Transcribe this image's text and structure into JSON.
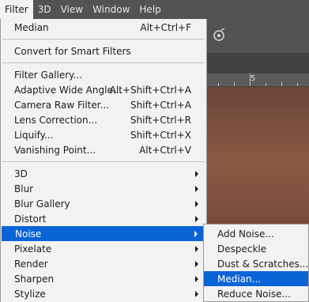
{
  "menubar": {
    "items": [
      {
        "label": "Filter",
        "active": true
      },
      {
        "label": "3D",
        "active": false
      },
      {
        "label": "View",
        "active": false
      },
      {
        "label": "Window",
        "active": false
      },
      {
        "label": "Help",
        "active": false
      }
    ]
  },
  "ruler": {
    "label": "5"
  },
  "filter_menu": {
    "last_filter": {
      "label": "Median",
      "shortcut": "Alt+Ctrl+F"
    },
    "convert": {
      "label": "Convert for Smart Filters"
    },
    "filter_gallery": {
      "label": "Filter Gallery..."
    },
    "adaptive_wide_angle": {
      "label": "Adaptive Wide Angle...",
      "shortcut": "Alt+Shift+Ctrl+A"
    },
    "camera_raw": {
      "label": "Camera Raw Filter...",
      "shortcut": "Shift+Ctrl+A"
    },
    "lens_correction": {
      "label": "Lens Correction...",
      "shortcut": "Shift+Ctrl+R"
    },
    "liquify": {
      "label": "Liquify...",
      "shortcut": "Shift+Ctrl+X"
    },
    "vanishing_point": {
      "label": "Vanishing Point...",
      "shortcut": "Alt+Ctrl+V"
    },
    "submenus": [
      {
        "label": "3D"
      },
      {
        "label": "Blur"
      },
      {
        "label": "Blur Gallery"
      },
      {
        "label": "Distort"
      },
      {
        "label": "Noise"
      },
      {
        "label": "Pixelate"
      },
      {
        "label": "Render"
      },
      {
        "label": "Sharpen"
      },
      {
        "label": "Stylize"
      }
    ],
    "highlighted_submenu": "Noise"
  },
  "noise_submenu": {
    "items": [
      {
        "label": "Add Noise..."
      },
      {
        "label": "Despeckle"
      },
      {
        "label": "Dust & Scratches..."
      },
      {
        "label": "Median..."
      },
      {
        "label": "Reduce Noise..."
      }
    ],
    "highlighted_item": "Median..."
  },
  "colors": {
    "highlight": "#0a64d6",
    "menu_background": "#f2f2f2",
    "menubar_background": "#535353"
  }
}
